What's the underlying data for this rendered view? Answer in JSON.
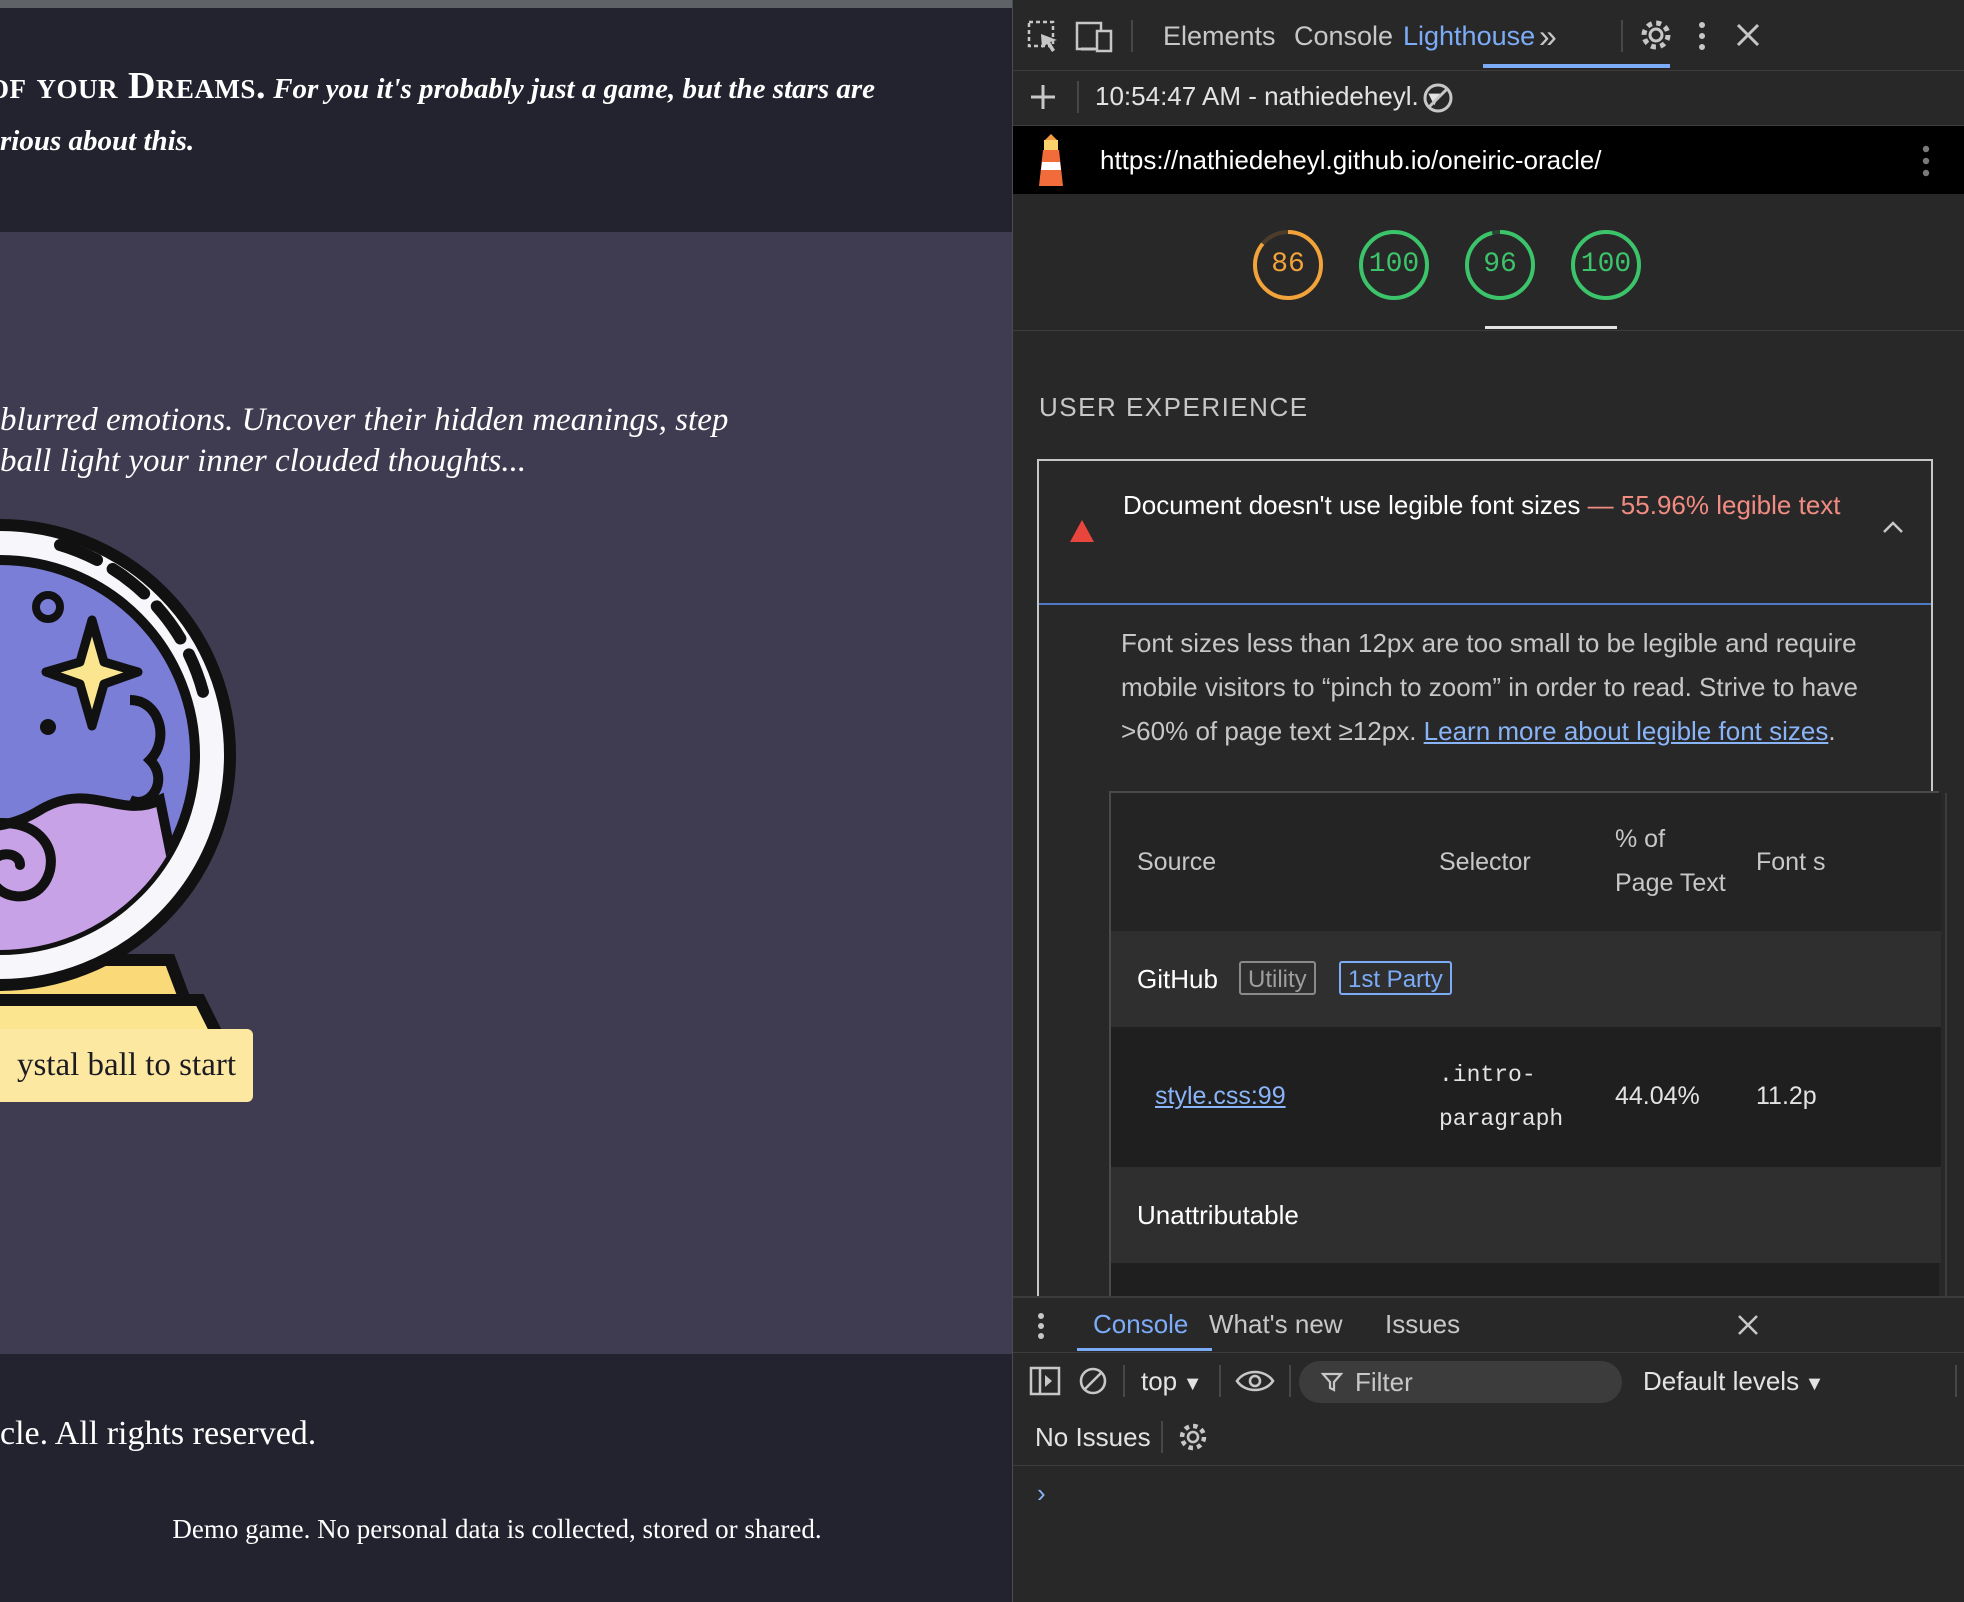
{
  "page": {
    "hero_caps": "of your Dreams.",
    "hero_line1": " For you it's probably just a game, but the stars are",
    "hero_line2": "rious about this.",
    "intro_line1": "blurred emotions. Uncover their hidden meanings, step",
    "intro_line2": "ball light your inner clouded thoughts...",
    "start_button": "ystal ball to start",
    "rights": "cle. All rights reserved.",
    "demo_note": "Demo game. No personal data is collected, stored or shared."
  },
  "devtools": {
    "tabs": [
      "Elements",
      "Console",
      "Lighthouse"
    ],
    "active_tab": "Lighthouse",
    "more_tabs_glyph": "»",
    "report_title": "10:54:47 AM - nathiedeheyl.",
    "url": "https://nathiedeheyl.github.io/oneiric-oracle/",
    "scores": [
      {
        "value": "86",
        "color": "#f2a33a",
        "fraction": 0.86
      },
      {
        "value": "100",
        "color": "#3cc46a",
        "fraction": 1.0
      },
      {
        "value": "96",
        "color": "#3cc46a",
        "fraction": 0.96
      },
      {
        "value": "100",
        "color": "#3cc46a",
        "fraction": 1.0
      }
    ],
    "section_title": "USER EXPERIENCE",
    "audit": {
      "title": "Document doesn't use legible font sizes",
      "display_value": "— 55.96% legible text",
      "description": "Font sizes less than 12px are too small to be legible and require mobile visitors to “pinch to zoom” in order to read. Strive to have >60% of page text ≥12px. ",
      "link_text": "Learn more about legible font sizes",
      "link_after": "."
    },
    "table": {
      "headers": {
        "source": "Source",
        "selector": "Selector",
        "pct_line1": "% of",
        "pct_line2": "Page Text",
        "font": "Font s"
      },
      "group1": {
        "name": "GitHub",
        "badge1": "Utility",
        "badge2": "1st Party"
      },
      "row1": {
        "source": "style.css:99",
        "selector_line1": ".intro-",
        "selector_line2": "paragraph",
        "pct": "44.04%",
        "font": "11.2p"
      },
      "group2": {
        "name": "Unattributable"
      }
    },
    "drawer": {
      "tabs": [
        "Console",
        "What's new",
        "Issues"
      ],
      "context": "top",
      "filter_placeholder": "Filter",
      "levels": "Default levels",
      "no_issues": "No Issues",
      "prompt": "›"
    },
    "colors": {
      "accent": "#7cacf8",
      "fail": "#f28b82",
      "pass": "#3cc46a",
      "average": "#f2a33a"
    }
  }
}
